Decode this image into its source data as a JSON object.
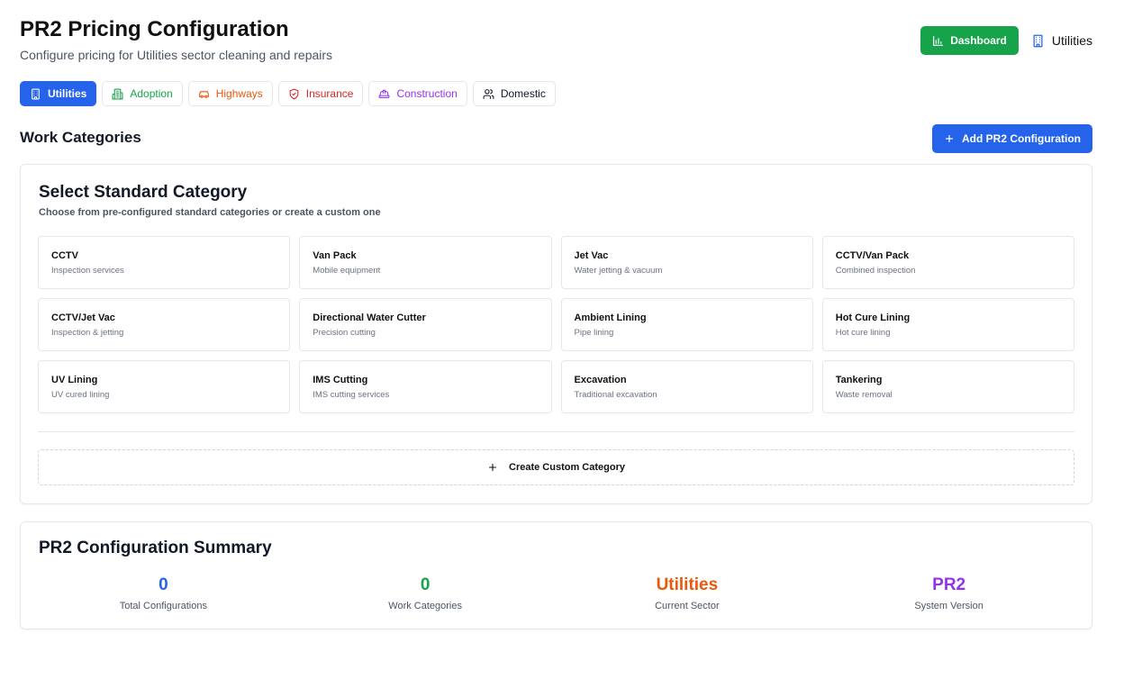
{
  "header": {
    "title": "PR2 Pricing Configuration",
    "subtitle": "Configure pricing for Utilities sector cleaning and repairs",
    "dashboard_label": "Dashboard",
    "utilities_label": "Utilities"
  },
  "tabs": [
    {
      "label": "Utilities",
      "icon": "building-icon",
      "color": "#2563eb",
      "active": true
    },
    {
      "label": "Adoption",
      "icon": "building-2-icon",
      "color": "#16a34a"
    },
    {
      "label": "Highways",
      "icon": "car-icon",
      "color": "#ea580c"
    },
    {
      "label": "Insurance",
      "icon": "shield-icon",
      "color": "#dc2626"
    },
    {
      "label": "Construction",
      "icon": "hard-hat-icon",
      "color": "#9333ea"
    },
    {
      "label": "Domestic",
      "icon": "users-icon",
      "color": "#111827"
    }
  ],
  "work_categories": {
    "title": "Work Categories",
    "add_button_label": "Add PR2 Configuration"
  },
  "select_category": {
    "title": "Select Standard Category",
    "description": "Choose from pre-configured standard categories or create a custom one",
    "categories": [
      {
        "name": "CCTV",
        "desc": "Inspection services"
      },
      {
        "name": "Van Pack",
        "desc": "Mobile equipment"
      },
      {
        "name": "Jet Vac",
        "desc": "Water jetting & vacuum"
      },
      {
        "name": "CCTV/Van Pack",
        "desc": "Combined inspection"
      },
      {
        "name": "CCTV/Jet Vac",
        "desc": "Inspection & jetting"
      },
      {
        "name": "Directional Water Cutter",
        "desc": "Precision cutting"
      },
      {
        "name": "Ambient Lining",
        "desc": "Pipe lining"
      },
      {
        "name": "Hot Cure Lining",
        "desc": "Hot cure lining"
      },
      {
        "name": "UV Lining",
        "desc": "UV cured lining"
      },
      {
        "name": "IMS Cutting",
        "desc": "IMS cutting services"
      },
      {
        "name": "Excavation",
        "desc": "Traditional excavation"
      },
      {
        "name": "Tankering",
        "desc": "Waste removal"
      }
    ],
    "custom_label": "Create Custom Category"
  },
  "summary": {
    "title": "PR2 Configuration Summary",
    "stats": [
      {
        "value": "0",
        "label": "Total Configurations",
        "color": "#2563eb"
      },
      {
        "value": "0",
        "label": "Work Categories",
        "color": "#16a34a"
      },
      {
        "value": "Utilities",
        "label": "Current Sector",
        "color": "#ea580c"
      },
      {
        "value": "PR2",
        "label": "System Version",
        "color": "#9333ea"
      }
    ]
  }
}
